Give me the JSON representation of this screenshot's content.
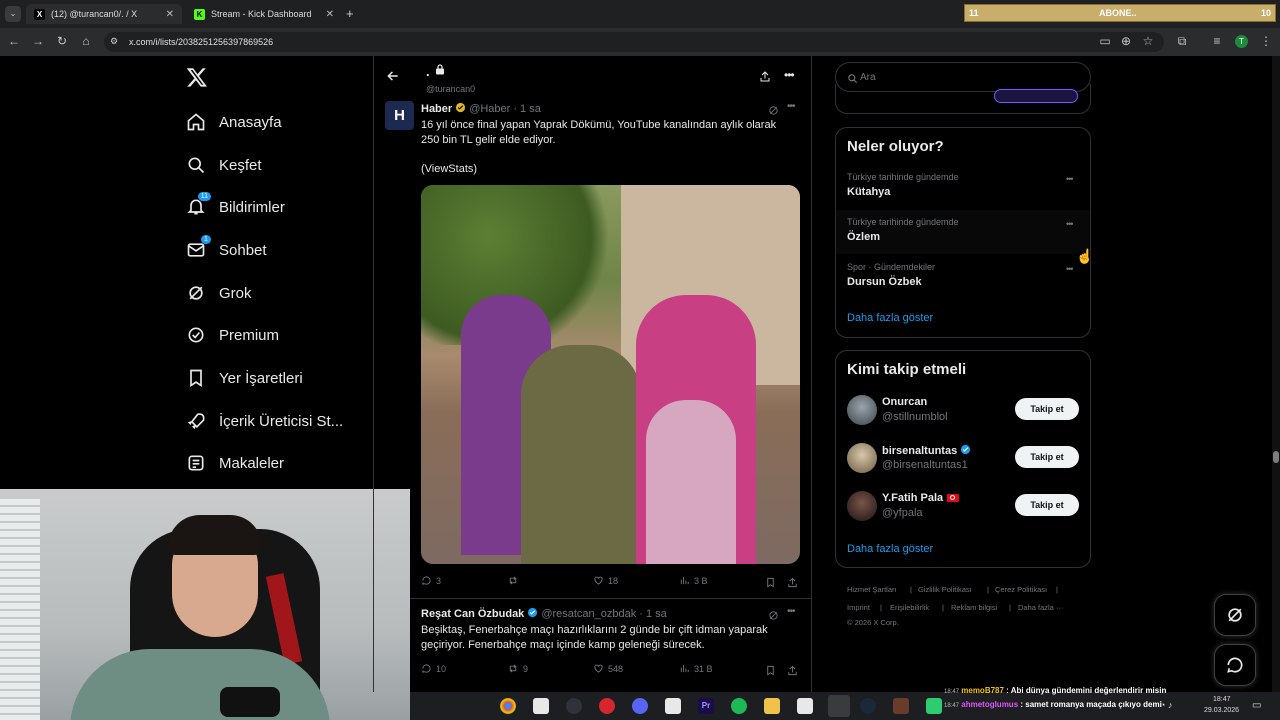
{
  "browser": {
    "tabs": [
      {
        "title": "(12) @turancan0/. / X"
      },
      {
        "title": "Stream - Kick Dashboard"
      }
    ],
    "url": "x.com/i/lists/2038251256397869526",
    "stream_widget": {
      "left": "11",
      "center": "ABONE..",
      "right": "10"
    }
  },
  "nav": {
    "items": [
      {
        "label": "Anasayfa",
        "icon": "home-icon"
      },
      {
        "label": "Keşfet",
        "icon": "search-icon"
      },
      {
        "label": "Bildirimler",
        "icon": "bell-icon",
        "badge": "11"
      },
      {
        "label": "Sohbet",
        "icon": "mail-icon",
        "badge": "1"
      },
      {
        "label": "Grok",
        "icon": "grok-icon"
      },
      {
        "label": "Premium",
        "icon": "premium-icon"
      },
      {
        "label": "Yer İşaretleri",
        "icon": "bookmark-icon"
      },
      {
        "label": "İçerik Üreticisi St...",
        "icon": "rocket-icon"
      },
      {
        "label": "Makaleler",
        "icon": "article-icon"
      }
    ]
  },
  "list_header": {
    "title": ".",
    "handle": "@turancan0"
  },
  "tweets": [
    {
      "author": "Haber",
      "handle": "@Haber",
      "time": "· 1 sa",
      "text": "16 yıl önce final yapan Yaprak Dökümü, YouTube kanalından aylık olarak 250 bin TL gelir elde ediyor.",
      "source": "(ViewStats)",
      "replies": "3",
      "retweets": "",
      "likes": "18",
      "views": "3 B"
    },
    {
      "author": "Reşat Can Özbudak",
      "handle": "@resatcan_ozbdak",
      "time": "· 1 sa",
      "text": "Beşiktaş, Fenerbahçe maçı hazırlıklarını 2 günde bir çift idman yaparak geçiriyor. Fenerbahçe maçı içinde kamp geleneği sürecek.",
      "replies": "10",
      "retweets": "9",
      "likes": "548",
      "views": "31 B"
    }
  ],
  "search": {
    "placeholder": "Ara"
  },
  "trends": {
    "title": "Neler oluyor?",
    "items": [
      {
        "category": "Türkiye tarihinde gündemde",
        "name": "Kütahya"
      },
      {
        "category": "Türkiye tarihinde gündemde",
        "name": "Özlem"
      },
      {
        "category": "Spor · Gündemdekiler",
        "name": "Dursun Özbek"
      }
    ],
    "more": "Daha fazla göster"
  },
  "who_to_follow": {
    "title": "Kimi takip etmeli",
    "users": [
      {
        "name": "Onurcan",
        "handle": "@stillnumblol",
        "verified": false,
        "button": "Takip et"
      },
      {
        "name": "birsenaltuntas",
        "handle": "@birsenaltuntas1",
        "verified": true,
        "button": "Takip et"
      },
      {
        "name": "Y.Fatih Pala",
        "handle": "@yfpala",
        "verified": false,
        "button": "Takip et"
      }
    ],
    "more": "Daha fazla göster"
  },
  "footer": {
    "links": [
      "Hizmet Şartları",
      "|",
      "Gizlilik Politikası",
      "|",
      "Çerez Politikası",
      "|",
      "Imprint",
      "|",
      "Erişilebilirlik",
      "|",
      "Reklam bilgisi",
      "|",
      "Daha fazla ···"
    ],
    "copyright": "© 2026 X Corp."
  },
  "chat_overlay": [
    {
      "time": "18:47",
      "user": "memoB787",
      "message": ": Abi dünya gündemini değerlendirir misin"
    },
    {
      "time": "18:47",
      "user": "ahmetoglumus",
      "message": ": samet romanya maçada çıkıyo demi"
    }
  ],
  "taskbar": {
    "time": "18:47",
    "date": "29.03.2026"
  },
  "colors": {
    "accent": "#1d9bf0",
    "background": "#000000",
    "border": "#2f3336",
    "muted": "#71767b"
  }
}
